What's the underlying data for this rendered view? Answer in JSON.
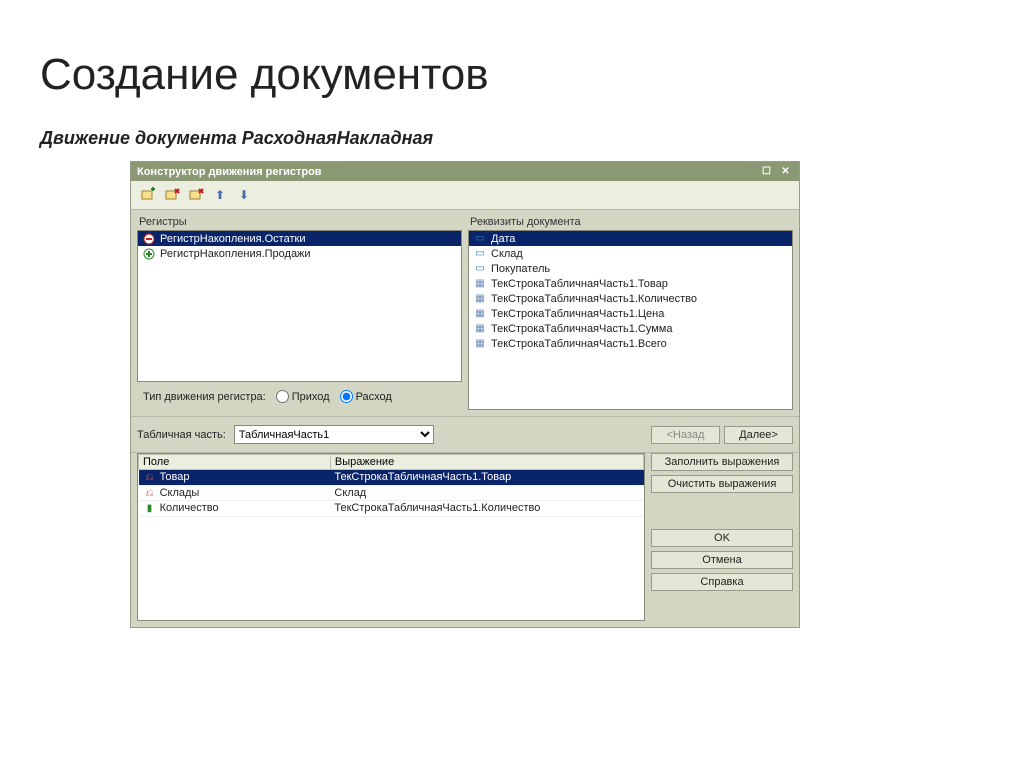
{
  "page": {
    "heading": "Создание документов",
    "subtitle": "Движение документа РасходнаяНакладная"
  },
  "window": {
    "title": "Конструктор движения регистров"
  },
  "registers": {
    "label": "Регистры",
    "items": [
      {
        "label": "РегистрНакопления.Остатки",
        "selected": true,
        "icon": "minus"
      },
      {
        "label": "РегистрНакопления.Продажи",
        "selected": false,
        "icon": "plus"
      }
    ]
  },
  "movementType": {
    "label": "Тип движения регистра:",
    "option1": "Приход",
    "option2": "Расход"
  },
  "requisites": {
    "label": "Реквизиты документа",
    "items": [
      "Дата",
      "Склад",
      "Покупатель",
      "ТекСтрокаТабличнаяЧасть1.Товар",
      "ТекСтрокаТабличнаяЧасть1.Количество",
      "ТекСтрокаТабличнаяЧасть1.Цена",
      "ТекСтрокаТабличнаяЧасть1.Сумма",
      "ТекСтрокаТабличнаяЧасть1.Всего"
    ]
  },
  "tabularPart": {
    "label": "Табличная часть:",
    "selected": "ТабличнаяЧасть1"
  },
  "mapping": {
    "headers": {
      "field": "Поле",
      "expr": "Выражение"
    },
    "rows": [
      {
        "field": "Товар",
        "expr": "ТекСтрокаТабличнаяЧасть1.Товар",
        "selected": true
      },
      {
        "field": "Склады",
        "expr": "Склад",
        "selected": false
      },
      {
        "field": "Количество",
        "expr": "ТекСтрокаТабличнаяЧасть1.Количество",
        "selected": false
      }
    ]
  },
  "buttons": {
    "back": "<Назад",
    "next": "Далее>",
    "fill": "Заполнить выражения",
    "clear": "Очистить выражения",
    "ok": "OK",
    "cancel": "Отмена",
    "help": "Справка"
  }
}
